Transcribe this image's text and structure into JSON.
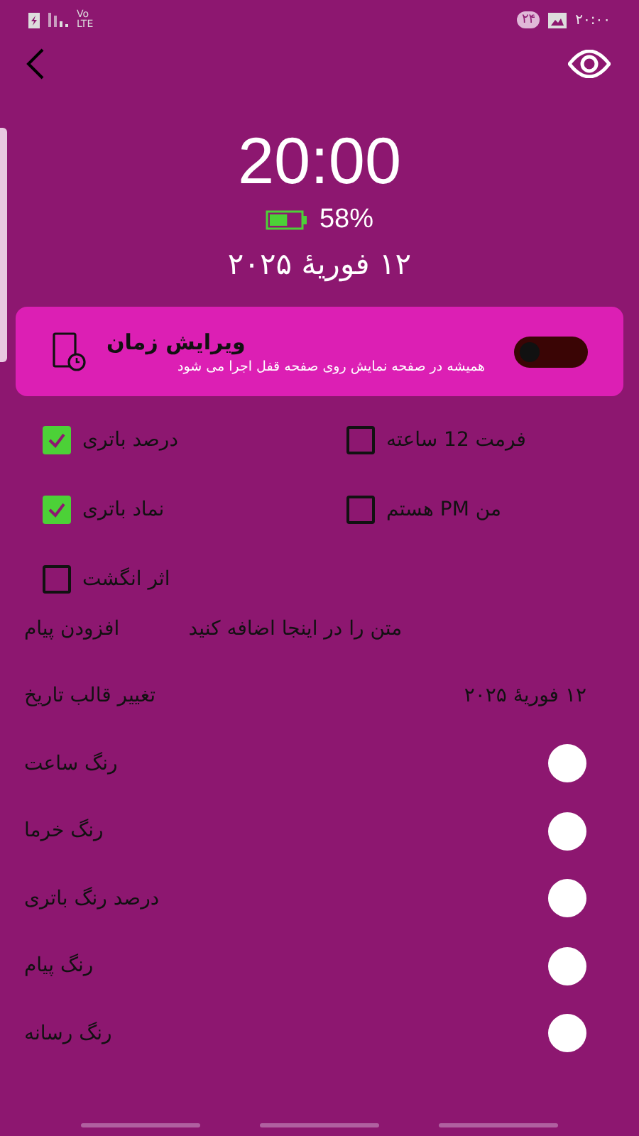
{
  "status_bar": {
    "time": "۲۰:۰۰",
    "badge": "۲۴",
    "network": "Vo LTE"
  },
  "clock": {
    "time": "20:00",
    "battery_percent": "58%",
    "level": 0.58,
    "date": "۱۲ فوریهٔ ۲۰۲۵"
  },
  "card": {
    "title": "ویرایش زمان",
    "subtitle": "همیشه در صفحه نمایش روی صفحه قفل اجرا می شود",
    "on": false
  },
  "options": [
    {
      "label": "فرمت 12 ساعته",
      "checked": false
    },
    {
      "label": "درصد باتری",
      "checked": true
    },
    {
      "label": "من PM هستم",
      "checked": false
    },
    {
      "label": "نماد باتری",
      "checked": true
    },
    {
      "label": "اثر انگشت",
      "checked": false
    }
  ],
  "message": {
    "label": "افزودن پیام",
    "placeholder": "متن را در اینجا اضافه کنید"
  },
  "date_format": {
    "label": "تغییر قالب تاریخ",
    "value": "۱۲ فوریهٔ ۲۰۲۵"
  },
  "colors": [
    {
      "label": "رنگ ساعت",
      "color": "#ffffff"
    },
    {
      "label": "رنگ خرما",
      "color": "#ffffff"
    },
    {
      "label": "درصد رنگ باتری",
      "color": "#ffffff"
    },
    {
      "label": "رنگ پیام",
      "color": "#ffffff"
    },
    {
      "label": "رنگ رسانه",
      "color": "#ffffff"
    }
  ]
}
